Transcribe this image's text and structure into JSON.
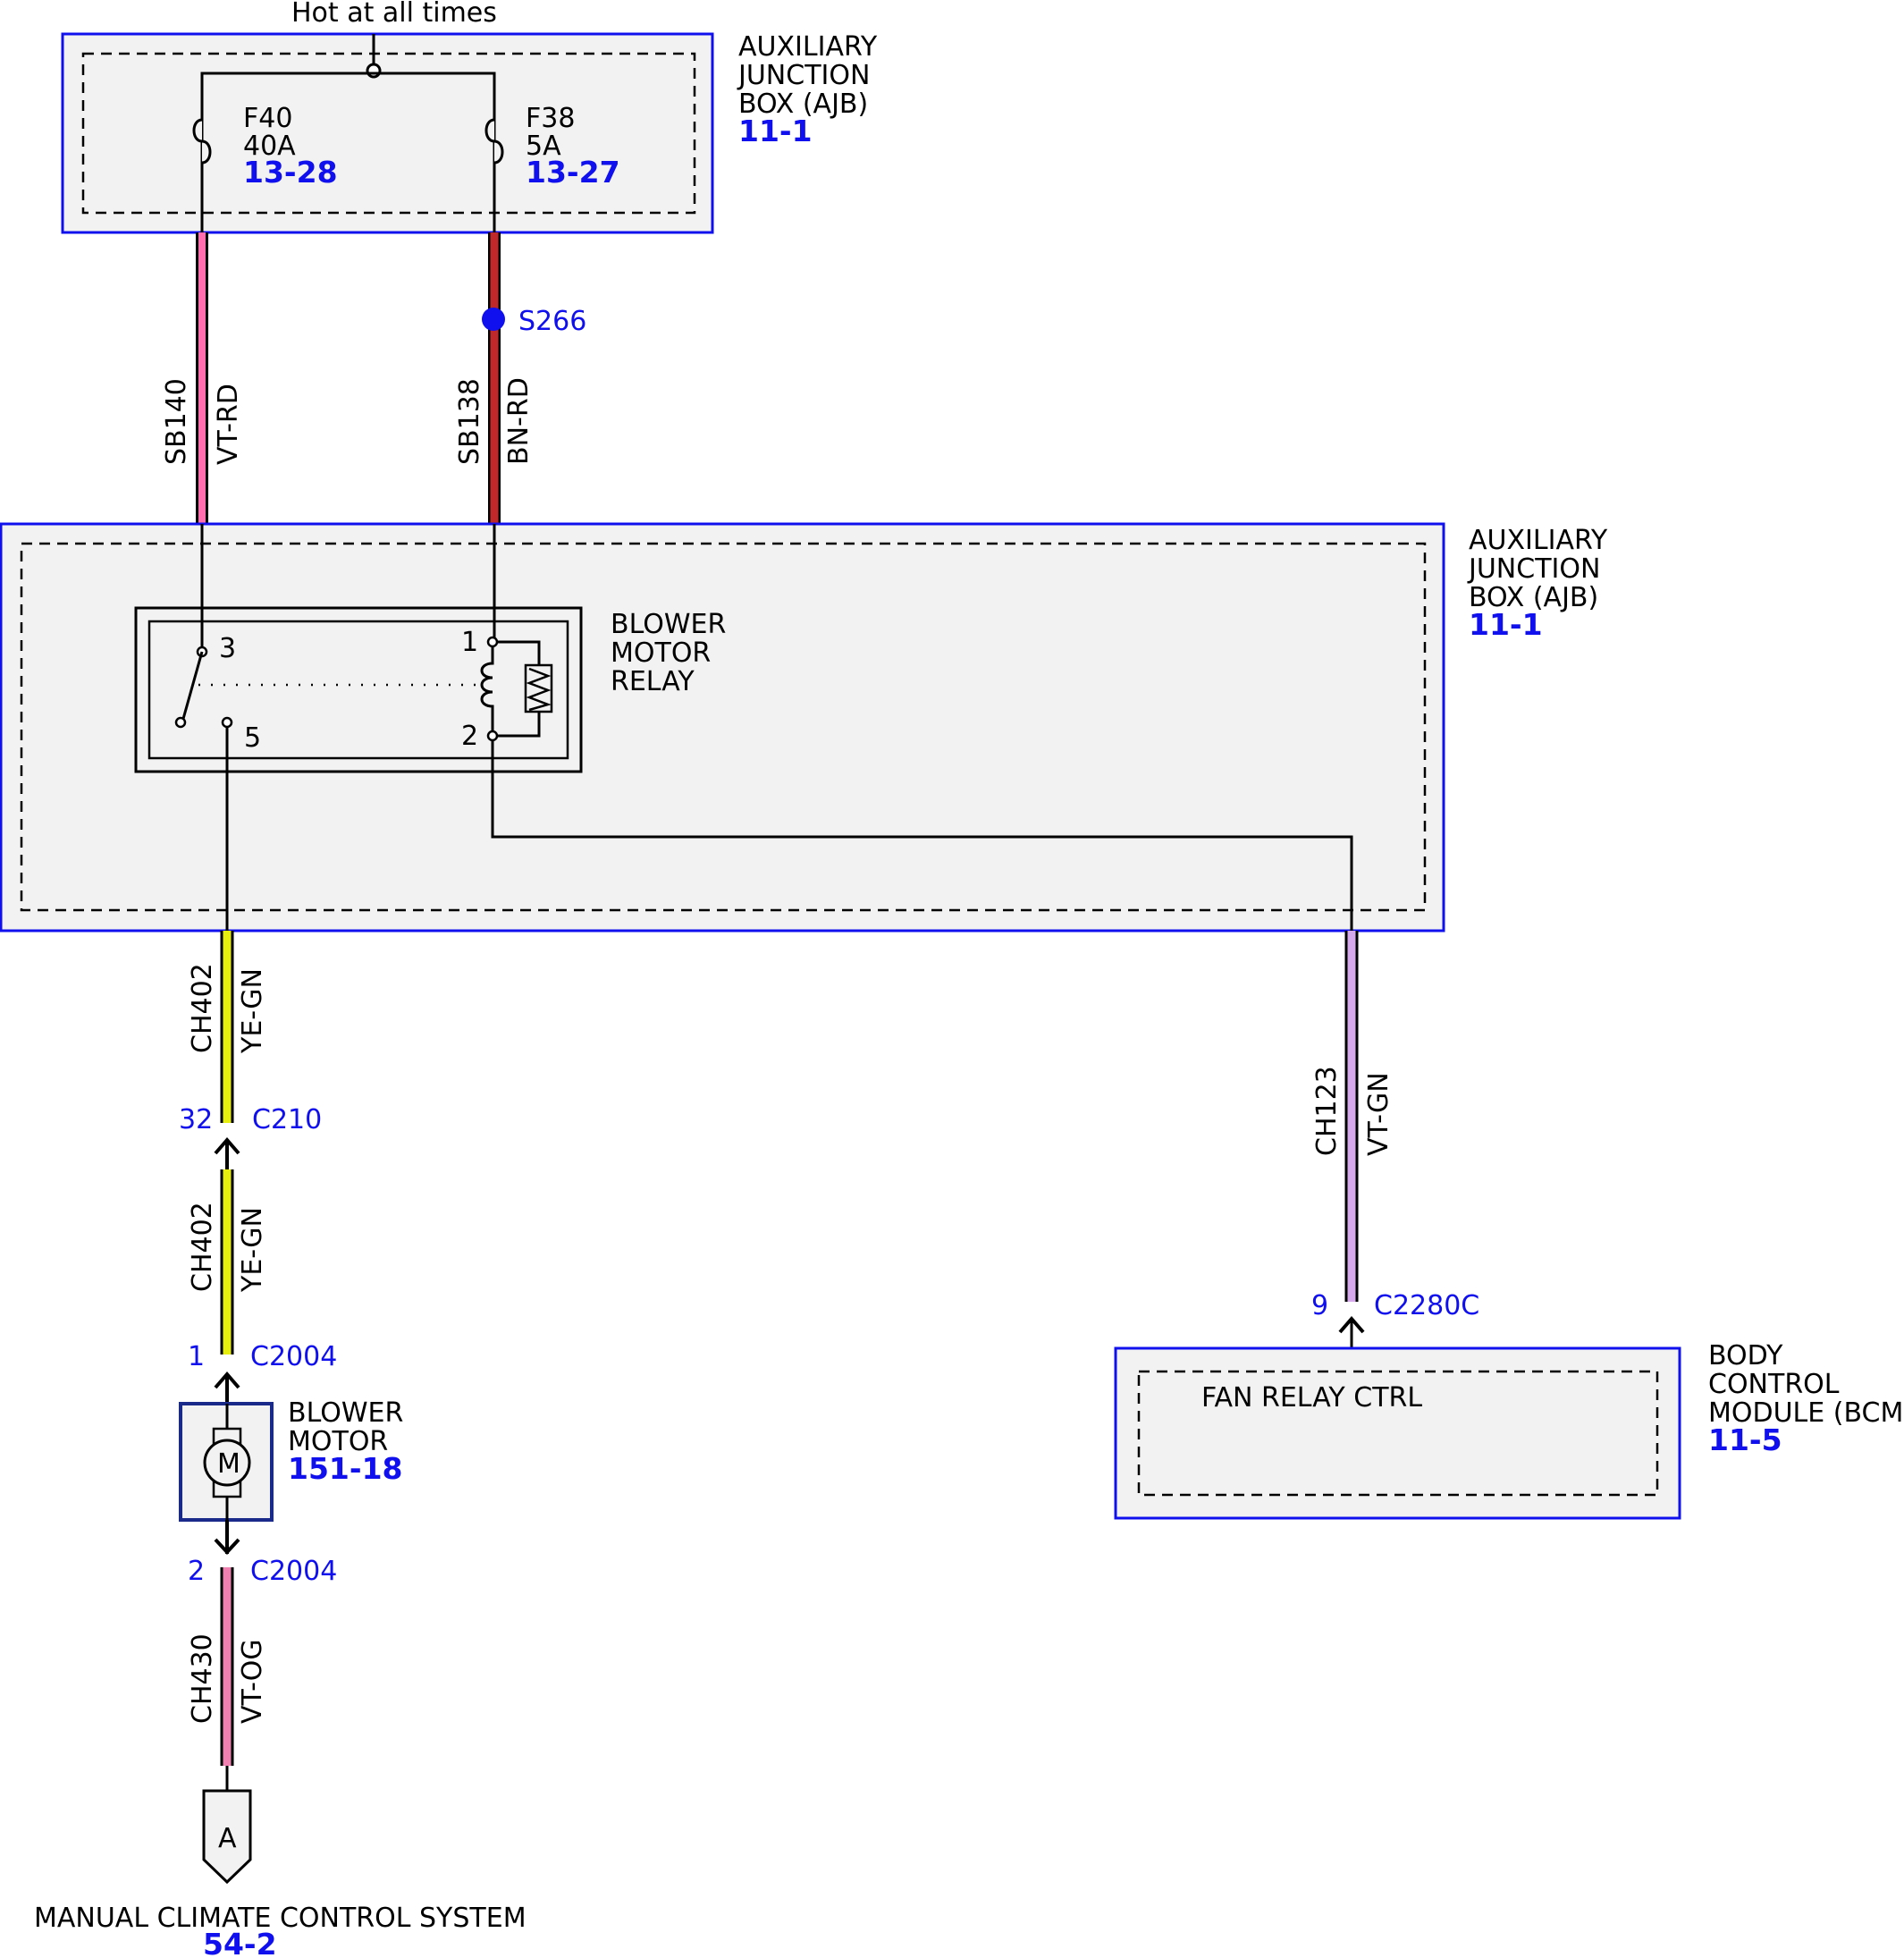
{
  "power": {
    "label": "Hot at all times"
  },
  "ajb_top": {
    "lines": [
      "AUXILIARY",
      "JUNCTION",
      "BOX (AJB)"
    ],
    "ref": "11-1"
  },
  "fuses": [
    {
      "name": "F40",
      "rating": "40A",
      "ref": "13-28"
    },
    {
      "name": "F38",
      "rating": "5A",
      "ref": "13-27"
    }
  ],
  "splice": {
    "label": "S266"
  },
  "wires": {
    "sb140": {
      "circuit": "SB140",
      "color": "VT-RD"
    },
    "sb138": {
      "circuit": "SB138",
      "color": "BN-RD"
    },
    "ch402_upper": {
      "circuit": "CH402",
      "color": "YE-GN"
    },
    "ch402_lower": {
      "circuit": "CH402",
      "color": "YE-GN"
    },
    "ch123": {
      "circuit": "CH123",
      "color": "VT-GN"
    },
    "ch430": {
      "circuit": "CH430",
      "color": "VT-OG"
    }
  },
  "ajb_mid": {
    "lines": [
      "AUXILIARY",
      "JUNCTION",
      "BOX (AJB)"
    ],
    "ref": "11-1"
  },
  "relay": {
    "lines": [
      "BLOWER",
      "MOTOR",
      "RELAY"
    ],
    "pins": [
      "3",
      "5",
      "1",
      "2"
    ]
  },
  "connectors": {
    "c210": {
      "pin": "32",
      "name": "C210"
    },
    "c2004_top": {
      "pin": "1",
      "name": "C2004"
    },
    "c2004_bottom": {
      "pin": "2",
      "name": "C2004"
    },
    "c2280c": {
      "pin": "9",
      "name": "C2280C"
    }
  },
  "blower_motor": {
    "lines": [
      "BLOWER",
      "MOTOR"
    ],
    "ref": "151-18",
    "symbol": "M"
  },
  "bcm": {
    "lines": [
      "BODY",
      "CONTROL",
      "MODULE (BCM)"
    ],
    "ref": "11-5",
    "signal": "FAN RELAY CTRL"
  },
  "ground_ref": {
    "letter": "A",
    "system": "MANUAL CLIMATE CONTROL SYSTEM",
    "ref": "54-2"
  },
  "colors": {
    "box_border": "#1010ee",
    "box_fill": "#f2f2f2",
    "vt_rd": "#ff6fb0",
    "bn_rd": "#c0282a",
    "ye_gn": "#e6ee10",
    "vt_gn": "#d6a8ec",
    "vt_og": "#f080b0"
  }
}
